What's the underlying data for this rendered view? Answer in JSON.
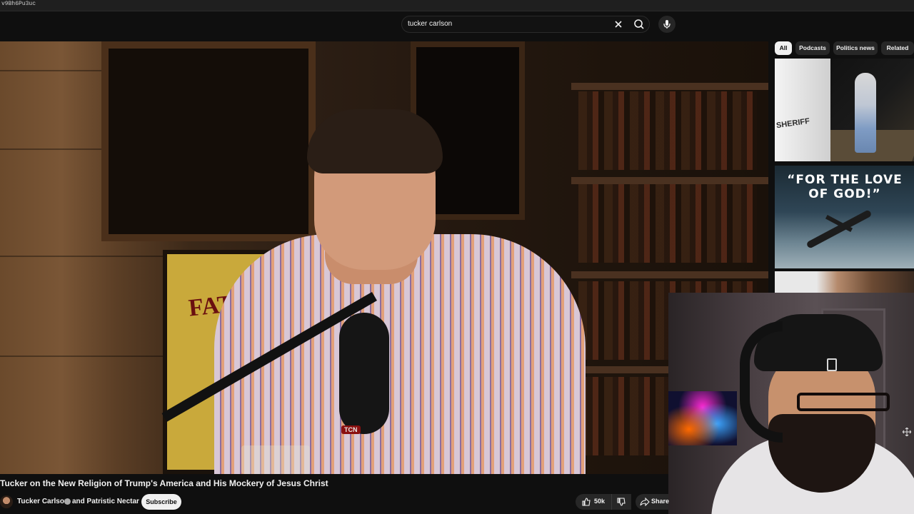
{
  "browser": {
    "url_fragment": "v9Bh6Pu3uc"
  },
  "search": {
    "query": "tucker carlson",
    "clear_icon": "close-icon",
    "search_icon": "search-icon",
    "mic_icon": "microphone-icon"
  },
  "chips": [
    {
      "label": "All",
      "active": true
    },
    {
      "label": "Podcasts",
      "active": false
    },
    {
      "label": "Politics news",
      "active": false
    },
    {
      "label": "Related",
      "active": false
    }
  ],
  "player": {
    "poster_text": "FATIM",
    "mic_brand": "TCN"
  },
  "sidebar": {
    "thumbs": [
      {
        "text": "SHERIFF"
      },
      {
        "text": "“FOR THE LOVE OF GOD!”"
      },
      {
        "text": ""
      }
    ]
  },
  "video": {
    "title": "Tucker on the New Religion of Trump's America and His Mockery of Jesus Christ",
    "channel": "Tucker Carlson",
    "collab": "and Patristic Nectar",
    "subscribe_label": "Subscribe",
    "likes": "50k",
    "share_label": "Share"
  },
  "colors": {
    "background": "#0f0f0f",
    "chip_active": "#f1f1f1",
    "chip": "#272727"
  }
}
